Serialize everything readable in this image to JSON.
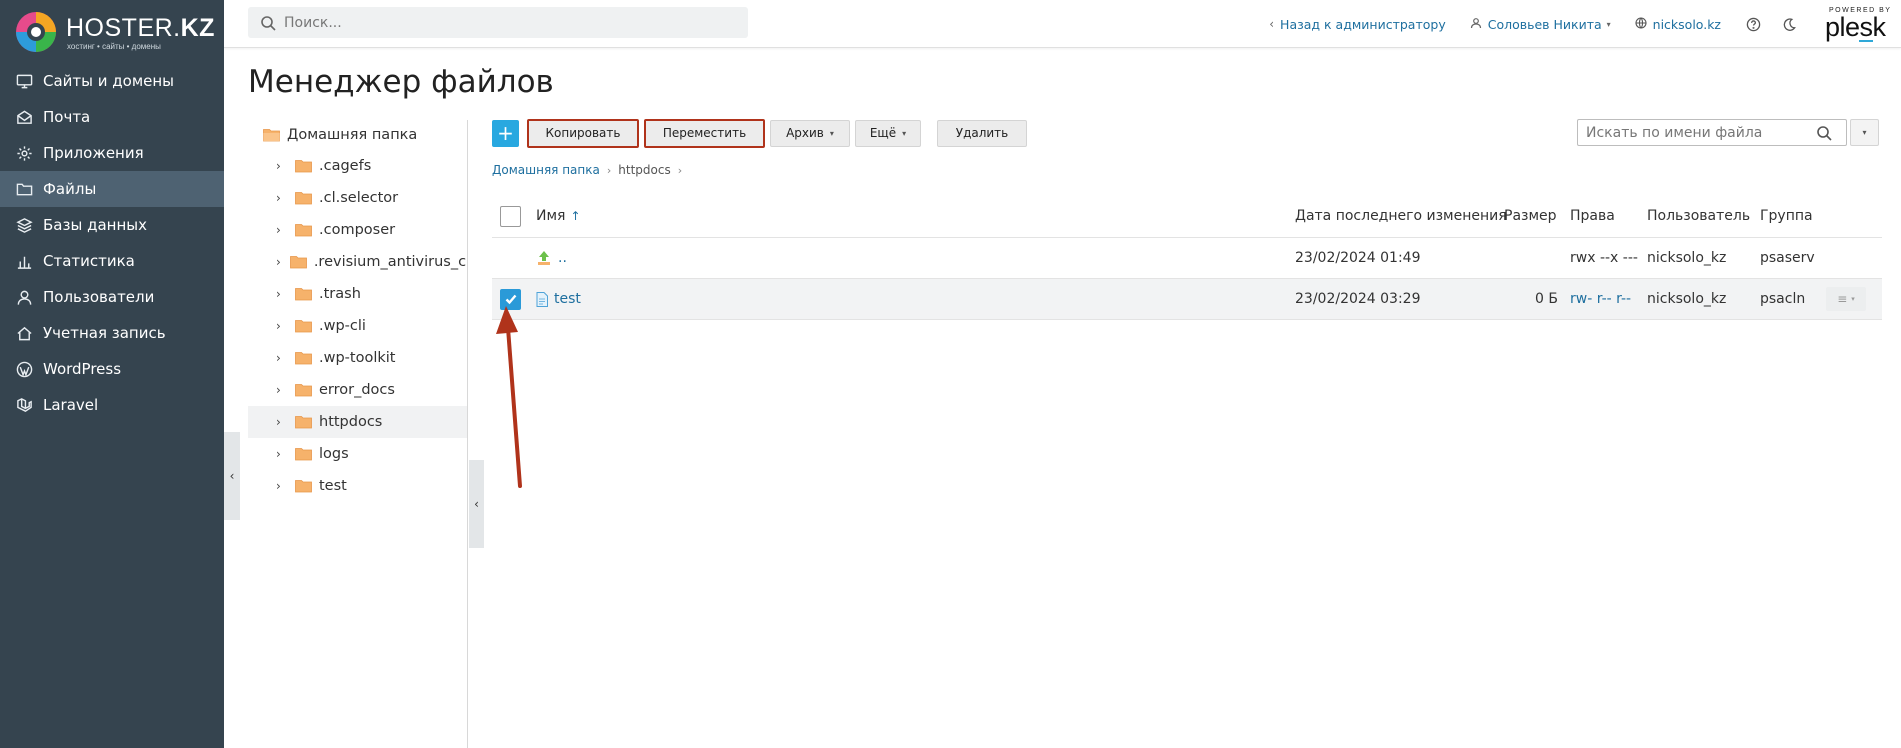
{
  "brand": {
    "name_light": "HOSTER.",
    "name_bold": "KZ",
    "tagline": "хостинг • сайты • домены"
  },
  "sidebar": {
    "items": [
      {
        "label": "Сайты и домены",
        "icon": "monitor-icon"
      },
      {
        "label": "Почта",
        "icon": "mail-icon"
      },
      {
        "label": "Приложения",
        "icon": "gear-icon"
      },
      {
        "label": "Файлы",
        "icon": "folder-icon",
        "active": true
      },
      {
        "label": "Базы данных",
        "icon": "database-icon"
      },
      {
        "label": "Статистика",
        "icon": "chart-icon"
      },
      {
        "label": "Пользователи",
        "icon": "user-icon"
      },
      {
        "label": "Учетная запись",
        "icon": "account-icon"
      },
      {
        "label": "WordPress",
        "icon": "wordpress-icon"
      },
      {
        "label": "Laravel",
        "icon": "laravel-icon"
      }
    ]
  },
  "header": {
    "search_placeholder": "Поиск...",
    "back_link": "Назад к администратору",
    "user": "Соловьев Никита",
    "domain": "nicksolo.kz",
    "plesk_powered": "POWERED BY",
    "plesk_name": "plesk"
  },
  "page": {
    "title": "Менеджер файлов"
  },
  "tree": {
    "root": "Домашняя папка",
    "items": [
      {
        "label": ".cagefs"
      },
      {
        "label": ".cl.selector"
      },
      {
        "label": ".composer"
      },
      {
        "label": ".revisium_antivirus_cache"
      },
      {
        "label": ".trash"
      },
      {
        "label": ".wp-cli"
      },
      {
        "label": ".wp-toolkit"
      },
      {
        "label": "error_docs"
      },
      {
        "label": "httpdocs",
        "selected": true
      },
      {
        "label": "logs"
      },
      {
        "label": "test"
      }
    ]
  },
  "toolbar": {
    "add": "+",
    "copy": "Копировать",
    "move": "Переместить",
    "archive": "Архив",
    "more": "Ещё",
    "delete": "Удалить",
    "file_search_placeholder": "Искать по имени файла"
  },
  "breadcrumb": {
    "home": "Домашняя папка",
    "current": "httpdocs"
  },
  "table": {
    "columns": {
      "name": "Имя",
      "modified": "Дата последнего изменения",
      "size": "Размер",
      "perms": "Права",
      "user": "Пользователь",
      "group": "Группа"
    },
    "rows": [
      {
        "name": "..",
        "modified": "23/02/2024 01:49",
        "size": "",
        "perms": "rwx --x ---",
        "user": "nicksolo_kz",
        "group": "psaserv"
      },
      {
        "name": "test",
        "modified": "23/02/2024 03:29",
        "size": "0 Б",
        "perms": "rw- r-- r--",
        "user": "nicksolo_kz",
        "group": "psacln"
      }
    ]
  },
  "colors": {
    "sidebar": "#35444f",
    "accent": "#28a8e0",
    "link": "#1e6f9f",
    "highlight": "#b0331b"
  }
}
